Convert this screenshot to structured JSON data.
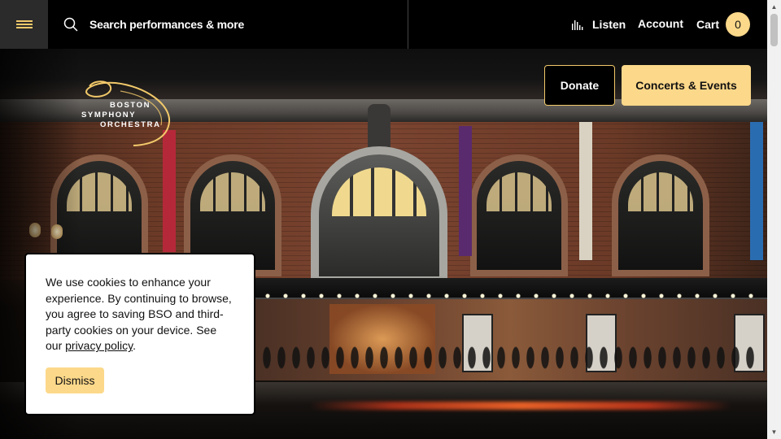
{
  "header": {
    "search_placeholder": "Search performances & more",
    "listen_label": "Listen",
    "account_label": "Account",
    "cart_label": "Cart",
    "cart_count": "0"
  },
  "logo": {
    "line1": "BOSTON",
    "line2": "SYMPHONY",
    "line3": "ORCHESTRA"
  },
  "cta": {
    "donate_label": "Donate",
    "concerts_label": "Concerts & Events"
  },
  "cookie_banner": {
    "text_before_link": "We use cookies to enhance your experience. By continuing to browse, you agree to saving BSO and third-party cookies on your device. See our ",
    "link_text": "privacy policy",
    "text_after_link": ".",
    "dismiss_label": "Dismiss"
  },
  "colors": {
    "accent": "#fcd88a",
    "accent_border": "#f2c96a",
    "background": "#000000"
  },
  "icons": {
    "menu": "hamburger-icon",
    "search": "search-icon",
    "listen": "audio-bars-icon"
  }
}
